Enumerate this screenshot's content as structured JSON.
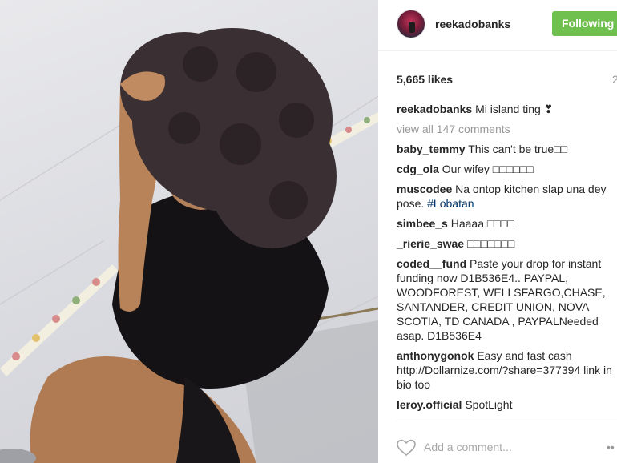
{
  "post": {
    "username": "reekadobanks",
    "follow_label": "Following",
    "likes": "5,665 likes",
    "time": "2",
    "caption_user": "reekadobanks",
    "caption_text": "Mi island ting ❣",
    "view_all": "view all 147 comments",
    "add_comment_placeholder": "Add a comment...",
    "more": "••"
  },
  "comments": [
    {
      "user": "baby_temmy",
      "text": "This can't be true□□"
    },
    {
      "user": "cdg_ola",
      "text": "Our wifey □□□□□□"
    },
    {
      "user": "muscodee",
      "text": "Na ontop kitchen slap una dey pose. ",
      "hashtag": "#Lobatan"
    },
    {
      "user": "simbee_s",
      "text": "Haaaa □□□□"
    },
    {
      "user": "_rierie_swae",
      "text": "□□□□□□□"
    },
    {
      "user": "coded__fund",
      "text": "Paste your drop for instant funding now D1B536E4.. PAYPAL, WOODFOREST, WELLSFARGO,CHASE, SANTANDER, CREDIT UNION, NOVA SCOTIA, TD CANADA , PAYPALNeeded asap. D1B536E4"
    },
    {
      "user": "anthonygonok",
      "text": "Easy and fast cash http://Dollarnize.com/?share=377394 link in bio too"
    },
    {
      "user": "leroy.official",
      "text": "SpotLight"
    }
  ],
  "colors": {
    "follow_button": "#70c050",
    "hashtag": "#003569",
    "muted_text": "#999999"
  },
  "icons": {
    "heart": "heart-icon",
    "avatar": "profile-avatar"
  }
}
